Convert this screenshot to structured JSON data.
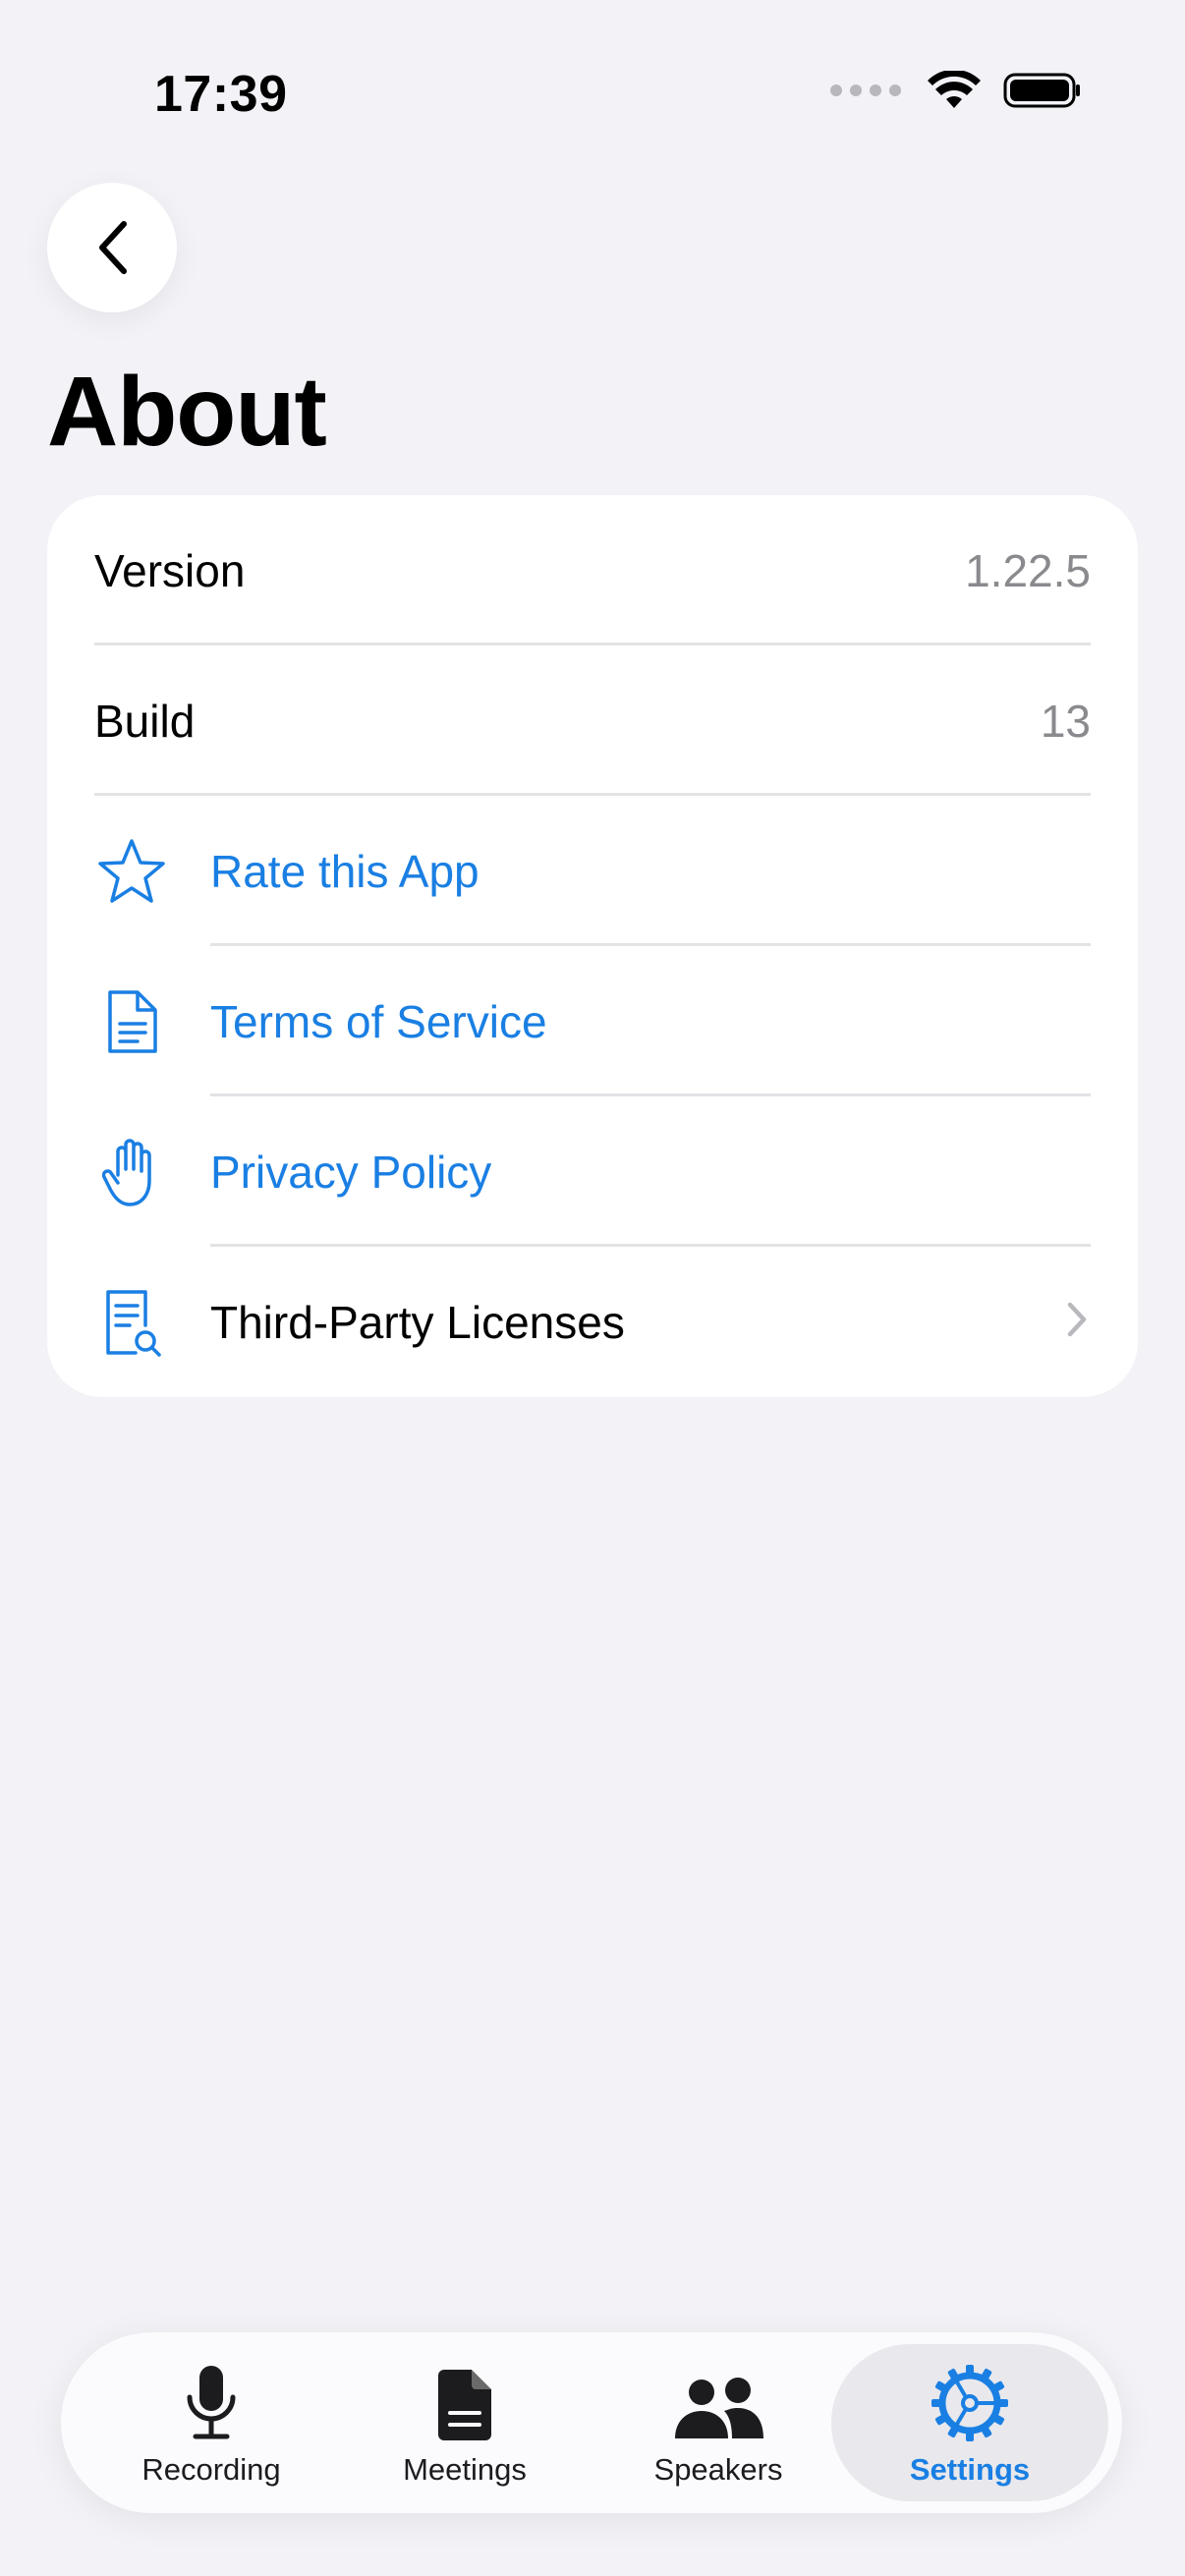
{
  "status_bar": {
    "time": "17:39"
  },
  "header": {
    "title": "About"
  },
  "about": {
    "version_label": "Version",
    "version_value": "1.22.5",
    "build_label": "Build",
    "build_value": "13",
    "rate_label": "Rate this App",
    "terms_label": "Terms of Service",
    "privacy_label": "Privacy Policy",
    "licenses_label": "Third-Party Licenses"
  },
  "tabs": [
    {
      "label": "Recording",
      "icon": "microphone-icon"
    },
    {
      "label": "Meetings",
      "icon": "document-icon"
    },
    {
      "label": "Speakers",
      "icon": "people-icon"
    },
    {
      "label": "Settings",
      "icon": "gear-icon",
      "active": true
    }
  ],
  "colors": {
    "accent": "#1a7fe3",
    "background": "#f2f2f7",
    "secondary_text": "#8a8a8e"
  }
}
